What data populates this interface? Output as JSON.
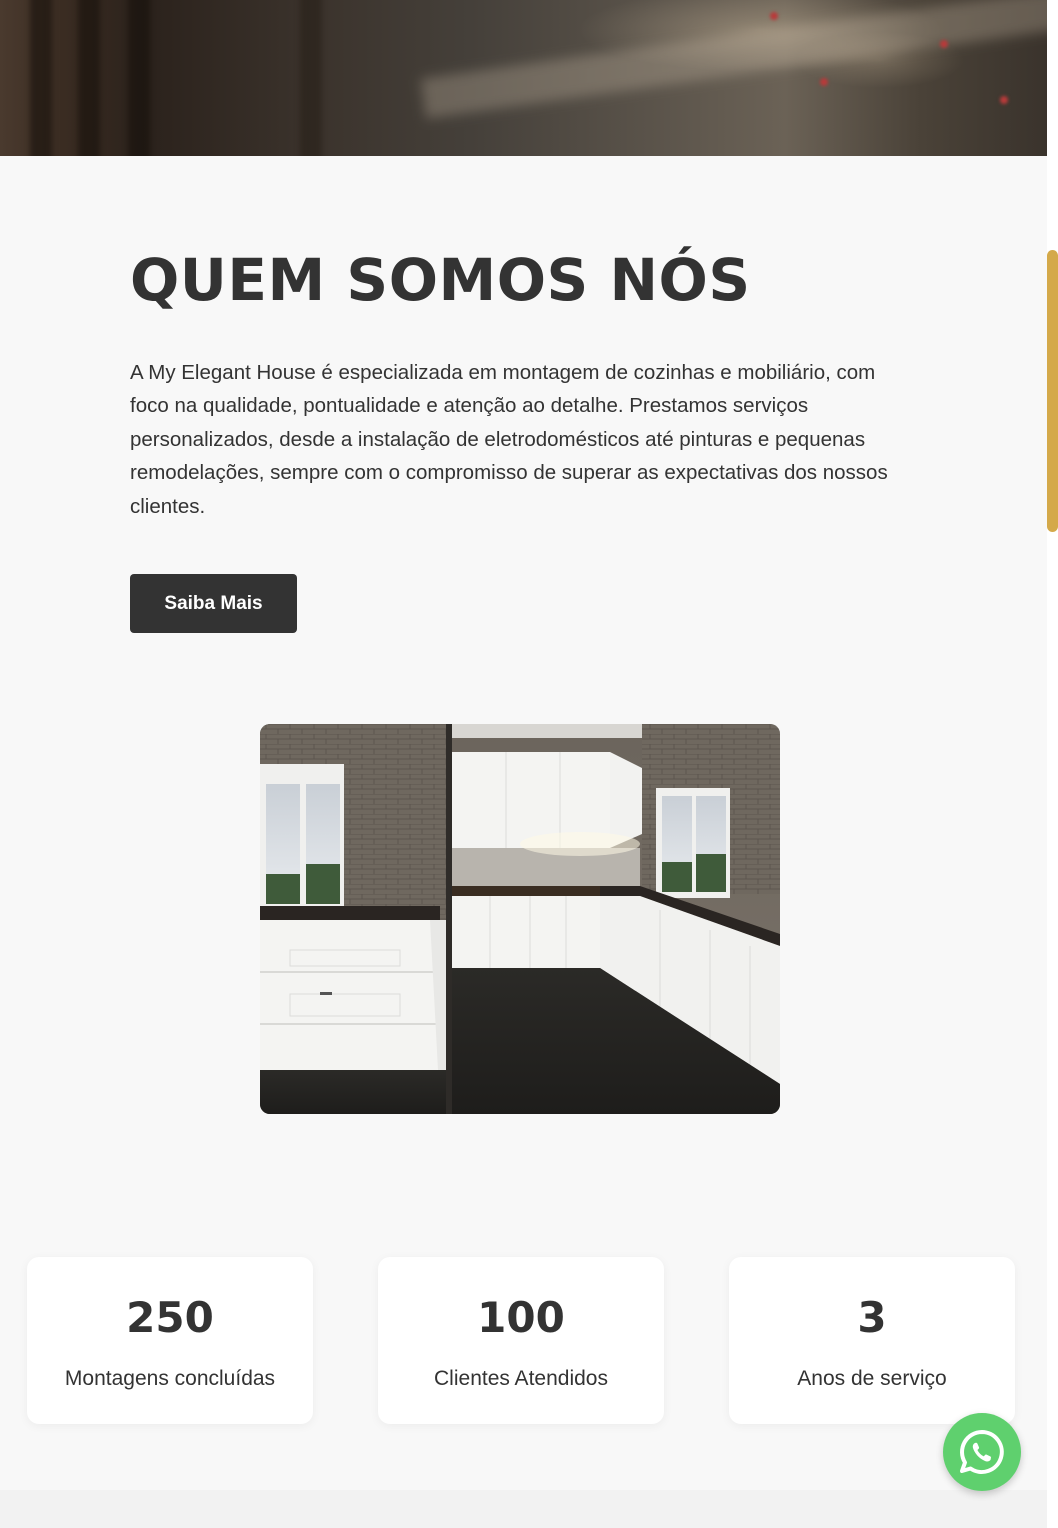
{
  "about": {
    "title": "QUEM SOMOS NÓS",
    "description": "A My Elegant House é especializada em montagem de cozinhas e mobiliário, com foco na qualidade, pontualidade e atenção ao detalhe. Prestamos serviços personalizados, desde a instalação de eletrodomésticos até pinturas e pequenas remodelações, sempre com o compromisso de superar as expectativas dos nossos clientes.",
    "button_label": "Saiba Mais"
  },
  "stats": [
    {
      "value": "250",
      "label": "Montagens concluídas"
    },
    {
      "value": "100",
      "label": "Clientes Atendidos"
    },
    {
      "value": "3",
      "label": "Anos de serviço"
    }
  ],
  "icons": {
    "whatsapp": "whatsapp-icon"
  },
  "colors": {
    "text": "#333333",
    "button_bg": "#333333",
    "page_bg": "#f8f8f8",
    "whatsapp": "#5fd06e",
    "scrollbar": "#d4a94a"
  }
}
